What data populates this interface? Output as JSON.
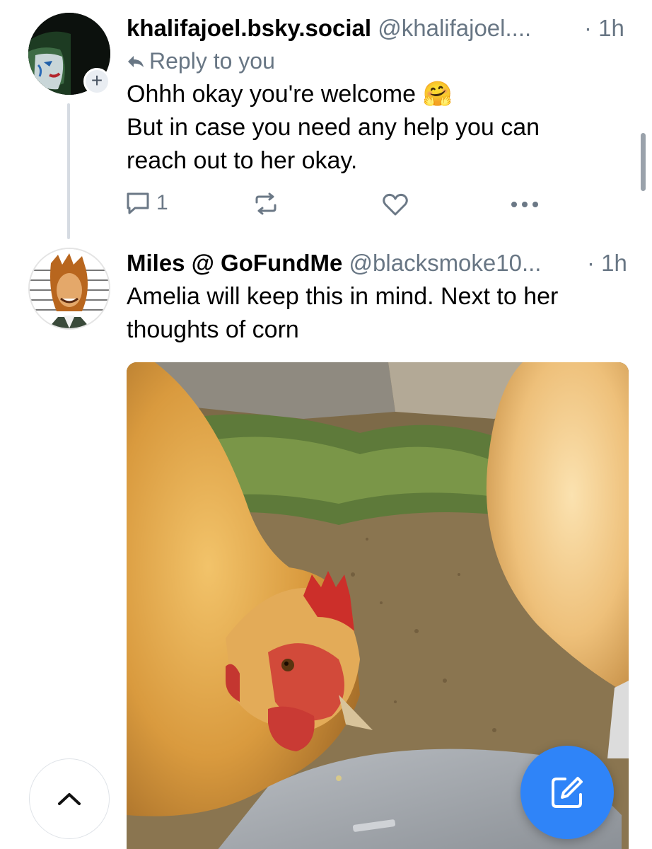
{
  "posts": [
    {
      "display_name": "khalifajoel.bsky.social",
      "handle": "@khalifajoel....",
      "timestamp": "· 1h",
      "reply_label": "Reply to you",
      "follow_badge": "+",
      "body_lines": [
        "Ohhh okay you're welcome 🤗",
        "But in case you need any help you can",
        "reach out to her okay."
      ],
      "reply_count": "1",
      "icons": [
        "reply-arrow-icon",
        "comment-icon",
        "repost-icon",
        "like-heart-icon",
        "more-options-icon"
      ]
    },
    {
      "display_name": "Miles @ GoFundMe",
      "handle": "@blacksmoke10...",
      "timestamp": "· 1h",
      "body_lines": [
        "Amelia will keep this in mind. Next to her",
        "thoughts of corn"
      ],
      "media": "photo of two golden hens pecking near a laptop"
    }
  ],
  "floating": {
    "scroll_top_icon": "chevron-up-icon",
    "compose_icon": "compose-pencil-icon"
  },
  "colors": {
    "secondary_text": "#687684",
    "accent_blue": "#2f84f8",
    "thread_line": "#d6dbe2"
  }
}
